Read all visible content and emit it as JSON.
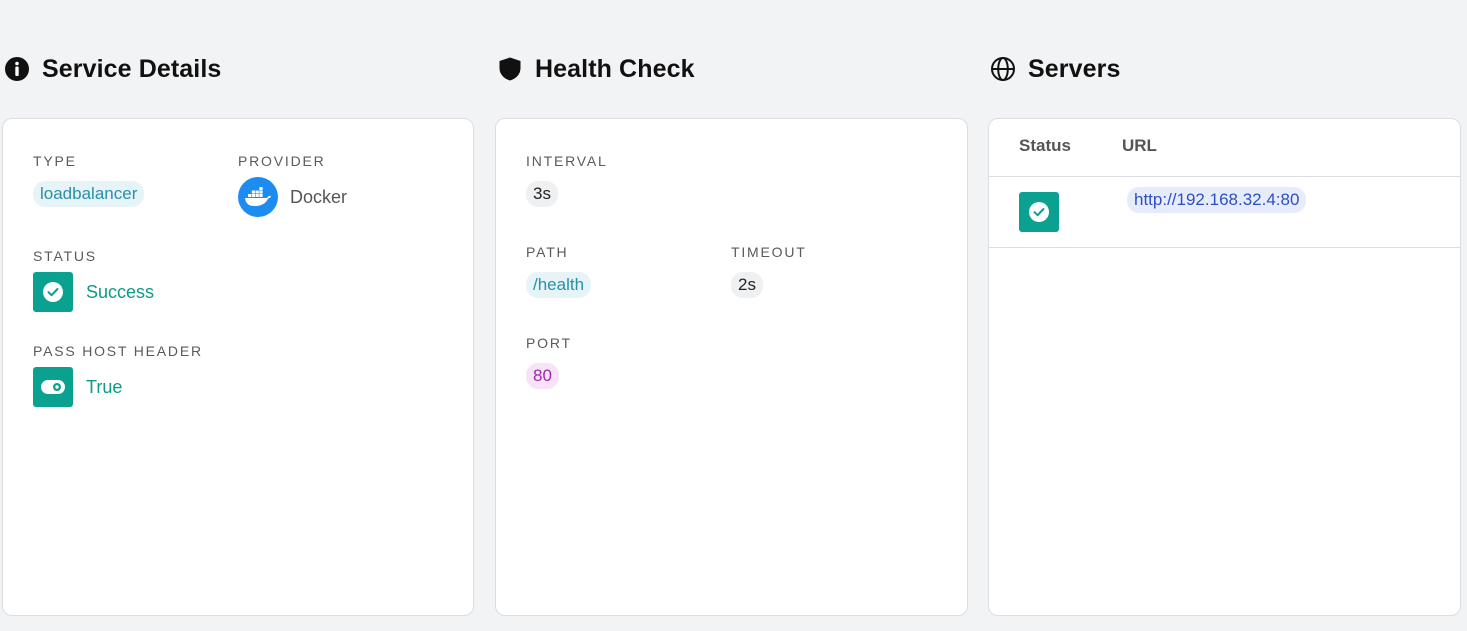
{
  "service_details": {
    "title": "Service Details",
    "type_label": "TYPE",
    "type_value": "loadbalancer",
    "provider_label": "PROVIDER",
    "provider_value": "Docker",
    "status_label": "STATUS",
    "status_value": "Success",
    "pass_host_header_label": "PASS HOST HEADER",
    "pass_host_header_value": "True"
  },
  "health_check": {
    "title": "Health Check",
    "interval_label": "INTERVAL",
    "interval_value": "3s",
    "path_label": "PATH",
    "path_value": "/health",
    "timeout_label": "TIMEOUT",
    "timeout_value": "2s",
    "port_label": "PORT",
    "port_value": "80"
  },
  "servers": {
    "title": "Servers",
    "columns": [
      "Status",
      "URL"
    ],
    "rows": [
      {
        "status": "success",
        "url": "http://192.168.32.4:80"
      }
    ]
  },
  "colors": {
    "background": "#f2f3f5",
    "success": "#0aa190",
    "docker_blue": "#1d8cf0",
    "chip_teal_text": "#2a8fa8",
    "chip_purple_text": "#9c2aa8",
    "chip_blue_text": "#2d4fc4"
  },
  "icons": {
    "service_details": "info-circle-icon",
    "health_check": "shield-icon",
    "servers": "globe-icon",
    "status": "check-circle-icon",
    "pass_host_header": "toggle-icon",
    "provider": "docker-icon"
  }
}
